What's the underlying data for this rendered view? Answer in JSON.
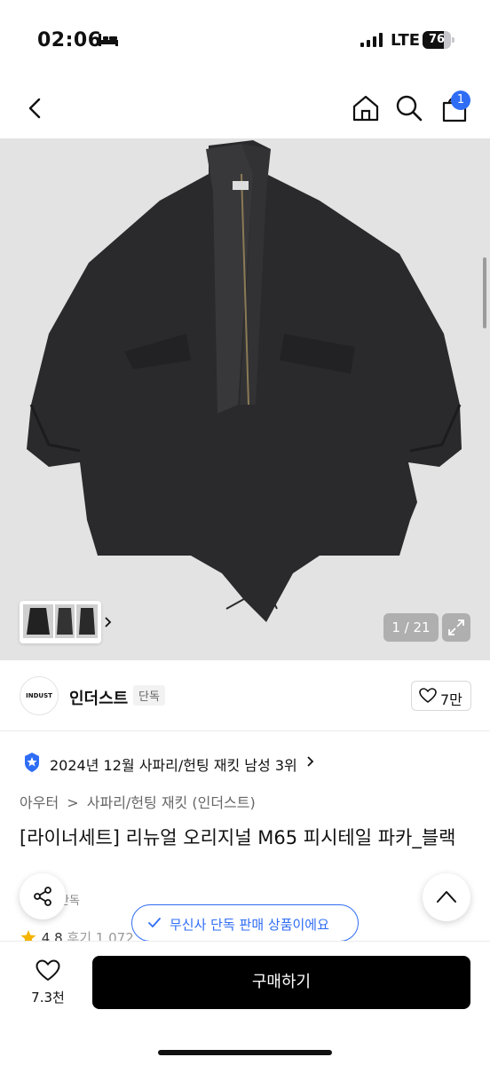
{
  "status_bar": {
    "time": "02:06",
    "network": "LTE",
    "battery_level": 76,
    "battery_text": "76"
  },
  "nav": {
    "cart_count": "1"
  },
  "gallery": {
    "pager": "1 / 21"
  },
  "brand": {
    "logo_text": "INDUST",
    "name": "인더스트",
    "tag": "단독",
    "like_count": "7만"
  },
  "ranking": {
    "text": "2024년 12월 사파리/헌팅 재킷 남성 3위"
  },
  "category": {
    "items": [
      "아우터",
      ">",
      "사파리/헌팅 재킷 (인더스트)"
    ]
  },
  "product": {
    "title": "[라이너세트] 리뉴얼 오리지널 M65 피시테일 파카_블랙",
    "exclusive_tag": "단독",
    "rating": "4.8",
    "reviews": "후기 1,072"
  },
  "floating": {
    "exclusive_pill": "무신사 단독 판매 상품이에요"
  },
  "bottom_bar": {
    "wish_count": "7.3천",
    "buy_label": "구매하기"
  },
  "colors": {
    "accent": "#2f6df5",
    "buy_button": "#000000",
    "image_bg": "#e3e3e3"
  },
  "icons": [
    "bed-icon",
    "signal-icon",
    "battery-icon",
    "back-icon",
    "home-icon",
    "search-icon",
    "cart-icon",
    "chevron-right-icon",
    "expand-icon",
    "heart-icon",
    "ranking-badge-icon",
    "star-icon",
    "share-icon",
    "check-icon",
    "chevron-up-icon"
  ]
}
